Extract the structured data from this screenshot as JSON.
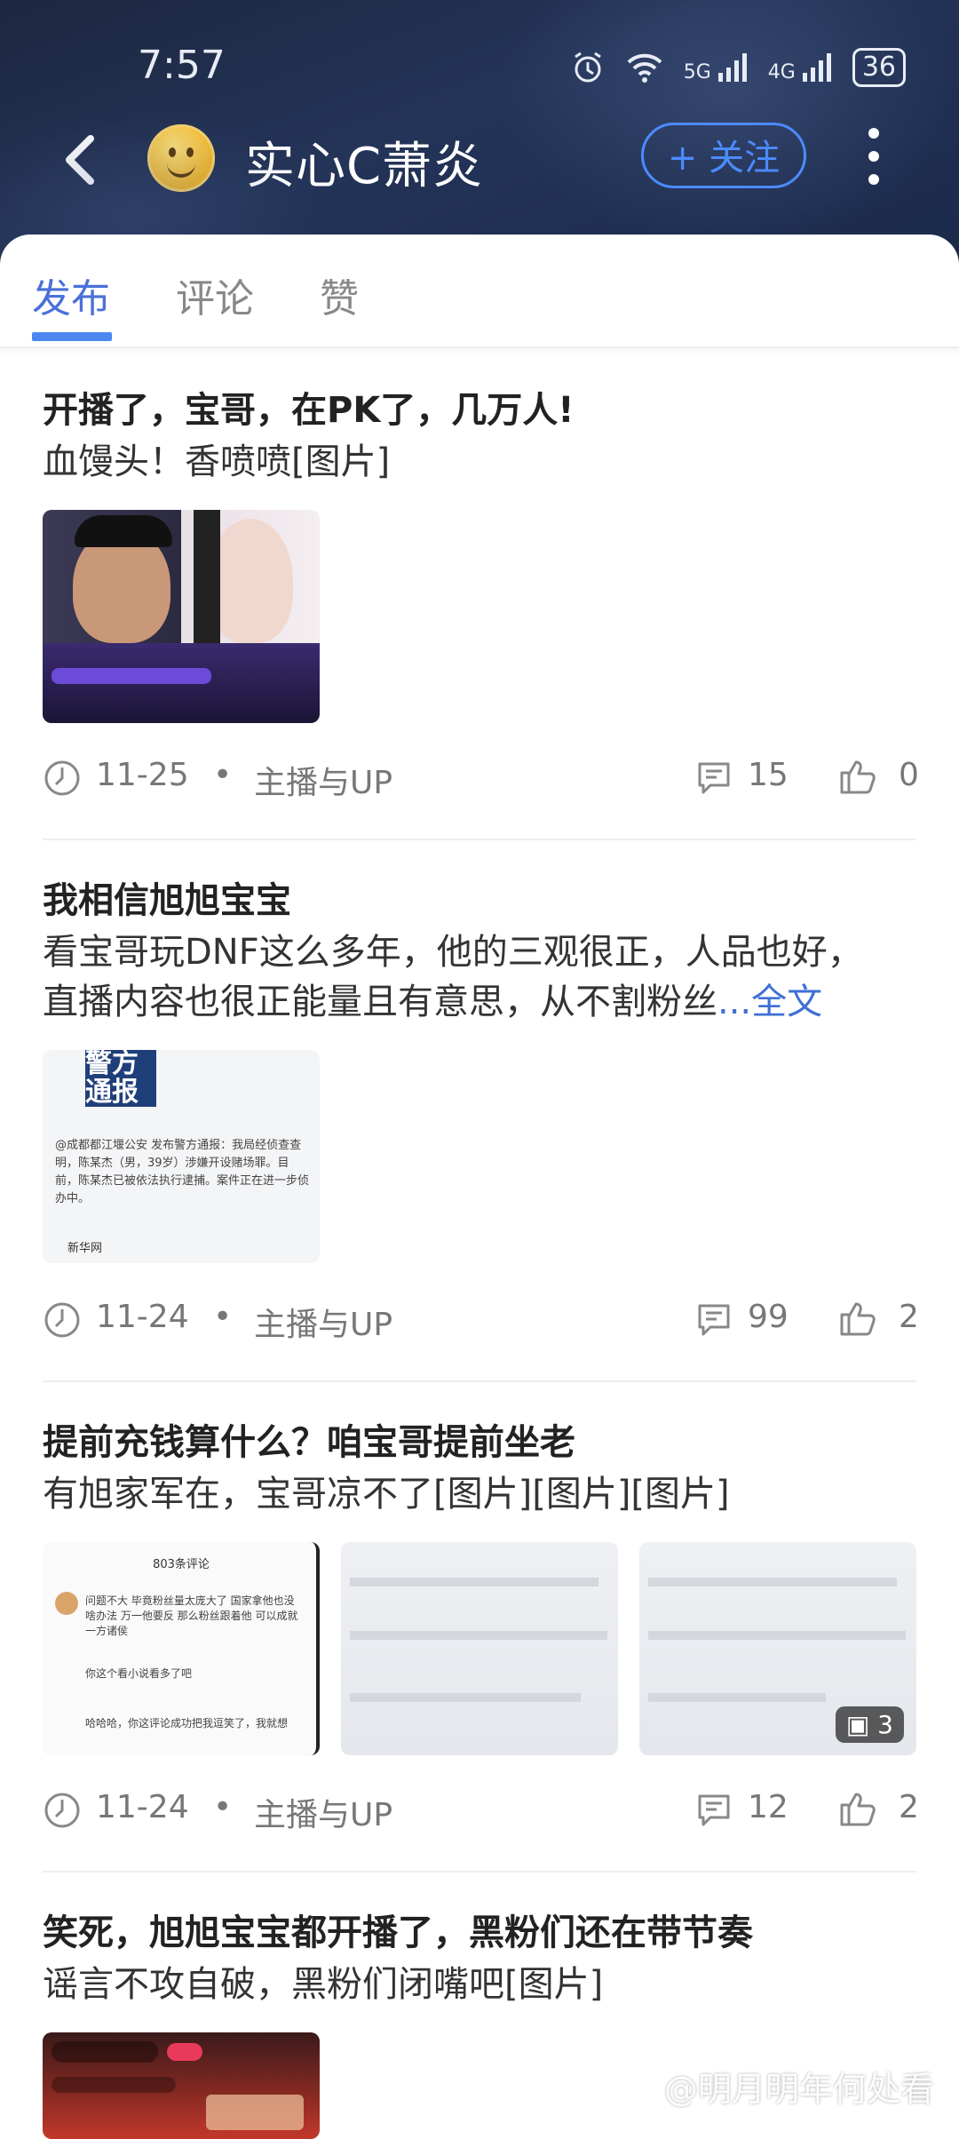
{
  "status_bar": {
    "time": "7:57",
    "net1": "5G",
    "net2": "4G",
    "battery": "36"
  },
  "header": {
    "title": "实心C萧炎",
    "follow_label": "+ 关注"
  },
  "tabs": [
    {
      "label": "发布"
    },
    {
      "label": "评论"
    },
    {
      "label": "赞"
    }
  ],
  "posts": [
    {
      "title": "开播了，宝哥，在PK了，几万人!",
      "body": "血馒头！香喷喷[图片]",
      "date": "11-25",
      "category": "主播与UP",
      "comments": "15",
      "likes": "0"
    },
    {
      "title": "我相信旭旭宝宝",
      "body_line1": "看宝哥玩DNF这么多年，他的三观很正，人品也好，",
      "body_line2": "直播内容也很正能量且有意思，从不割粉丝",
      "more": "...全文",
      "date": "11-24",
      "category": "主播与UP",
      "comments": "99",
      "likes": "2",
      "image_text": {
        "headline1": "警方",
        "headline2": "通报",
        "notice": "@成都都江堰公安 发布警方通报：我局经侦查查明，陈某杰（男，39岁）涉嫌开设赌场罪。目前，陈某杰已被依法执行逮捕。案件正在进一步侦办中。",
        "source": "新华网"
      }
    },
    {
      "title": "提前充钱算什么？咱宝哥提前坐老",
      "body": "有旭家军在，宝哥凉不了[图片][图片][图片]",
      "date": "11-24",
      "category": "主播与UP",
      "comments": "12",
      "likes": "2",
      "image_count": "3",
      "image_text": {
        "header": "803条评论",
        "c1": "问题不大 毕竟粉丝量太庞大了 国家拿他也没啥办法 万一他要反 那么粉丝跟着他 可以成就一方诸侯",
        "c2": "你这个看小说看多了吧",
        "c3": "哈哈哈，你这评论成功把我逗笑了，我就想"
      }
    },
    {
      "title": "笑死，旭旭宝宝都开播了，黑粉们还在带节奏",
      "body": "谣言不攻自破，黑粉们闭嘴吧[图片]"
    }
  ],
  "watermark": "@明月明年何处看",
  "icons": [
    "back-arrow-icon",
    "more-vertical-icon",
    "clock-icon",
    "comment-icon",
    "like-icon",
    "image-icon",
    "alarm-icon",
    "wifi-icon",
    "signal-icon",
    "battery-icon"
  ]
}
